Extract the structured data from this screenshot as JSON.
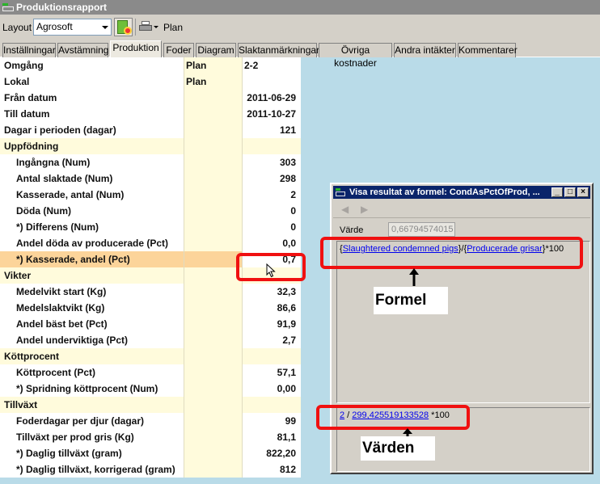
{
  "window": {
    "title": "Produktionsrapport"
  },
  "toolbar": {
    "layout_label": "Layout",
    "layout_value": "Agrosoft",
    "plan_label": "Plan"
  },
  "tabs": [
    {
      "label": "Inställningar",
      "active": false
    },
    {
      "label": "Avstämning",
      "active": false
    },
    {
      "label": "Produktion",
      "active": true
    },
    {
      "label": "Foder",
      "active": false
    },
    {
      "label": "Diagram",
      "active": false
    },
    {
      "label": "Slaktanmärkningar",
      "active": false
    },
    {
      "label": "Övriga kostnader",
      "active": false
    },
    {
      "label": "Andra intäkter",
      "active": false
    },
    {
      "label": "Kommentarer",
      "active": false
    }
  ],
  "grid": {
    "rows": [
      {
        "name": "Omgång",
        "plan": "Plan",
        "value": "2-2",
        "type": "header"
      },
      {
        "name": "Lokal",
        "plan": "Plan",
        "value": "",
        "type": "header"
      },
      {
        "name": "Från datum",
        "plan": "",
        "value": "2011-06-29",
        "type": "header"
      },
      {
        "name": "Till datum",
        "plan": "",
        "value": "2011-10-27",
        "type": "header"
      },
      {
        "name": "Dagar i perioden (dagar)",
        "plan": "",
        "value": "121",
        "type": "header"
      },
      {
        "name": "Uppfödning",
        "plan": "",
        "value": "",
        "type": "section"
      },
      {
        "name": "Ingångna (Num)",
        "plan": "",
        "value": "303",
        "type": "item"
      },
      {
        "name": "Antal slaktade (Num)",
        "plan": "",
        "value": "298",
        "type": "item"
      },
      {
        "name": "Kasserade, antal (Num)",
        "plan": "",
        "value": "2",
        "type": "item"
      },
      {
        "name": "Döda (Num)",
        "plan": "",
        "value": "0",
        "type": "item"
      },
      {
        "name": "*) Differens (Num)",
        "plan": "",
        "value": "0",
        "type": "item"
      },
      {
        "name": "Andel döda av producerade (Pct)",
        "plan": "",
        "value": "0,0",
        "type": "item"
      },
      {
        "name": "*) Kasserade, andel (Pct)",
        "plan": "",
        "value": "0,7",
        "type": "selected"
      },
      {
        "name": "Vikter",
        "plan": "",
        "value": "",
        "type": "section"
      },
      {
        "name": "Medelvikt start (Kg)",
        "plan": "",
        "value": "32,3",
        "type": "item"
      },
      {
        "name": "Medelslaktvikt (Kg)",
        "plan": "",
        "value": "86,6",
        "type": "item"
      },
      {
        "name": "Andel bäst bet (Pct)",
        "plan": "",
        "value": "91,9",
        "type": "item"
      },
      {
        "name": "Andel underviktiga (Pct)",
        "plan": "",
        "value": "2,7",
        "type": "item"
      },
      {
        "name": "Köttprocent",
        "plan": "",
        "value": "",
        "type": "section"
      },
      {
        "name": "Köttprocent (Pct)",
        "plan": "",
        "value": "57,1",
        "type": "item"
      },
      {
        "name": "*) Spridning köttprocent (Num)",
        "plan": "",
        "value": "0,00",
        "type": "item"
      },
      {
        "name": "Tillväxt",
        "plan": "",
        "value": "",
        "type": "section"
      },
      {
        "name": "Foderdagar per djur (dagar)",
        "plan": "",
        "value": "99",
        "type": "item"
      },
      {
        "name": "Tillväxt per prod gris (Kg)",
        "plan": "",
        "value": "81,1",
        "type": "item"
      },
      {
        "name": "*) Daglig tillväxt (gram)",
        "plan": "",
        "value": "822,20",
        "type": "item"
      },
      {
        "name": "*) Daglig tillväxt, korrigerad (gram)",
        "plan": "",
        "value": "812",
        "type": "item"
      }
    ]
  },
  "dialog": {
    "title": "Visa resultat av formel: CondAsPctOfProd, ...",
    "varde_label": "Värde",
    "varde_value": "0,66794574015",
    "formula": {
      "open_brace": "{",
      "link1": "Slaughtered condemned pigs",
      "sep": "}/{",
      "link2": "Producerade grisar",
      "tail": "}*100"
    },
    "values": {
      "link1": "2",
      "sep": " / ",
      "link2": "299,425519133528",
      "tail": " *100"
    }
  },
  "annotations": {
    "formel": "Formel",
    "varden": "Värden",
    "highlight_color": "#f01010"
  },
  "colors": {
    "plan_column": "#fffbdc",
    "selected_row": "#fcd49a",
    "background": "#b9dbe8",
    "dialog_titlebar": "#0a246a"
  }
}
